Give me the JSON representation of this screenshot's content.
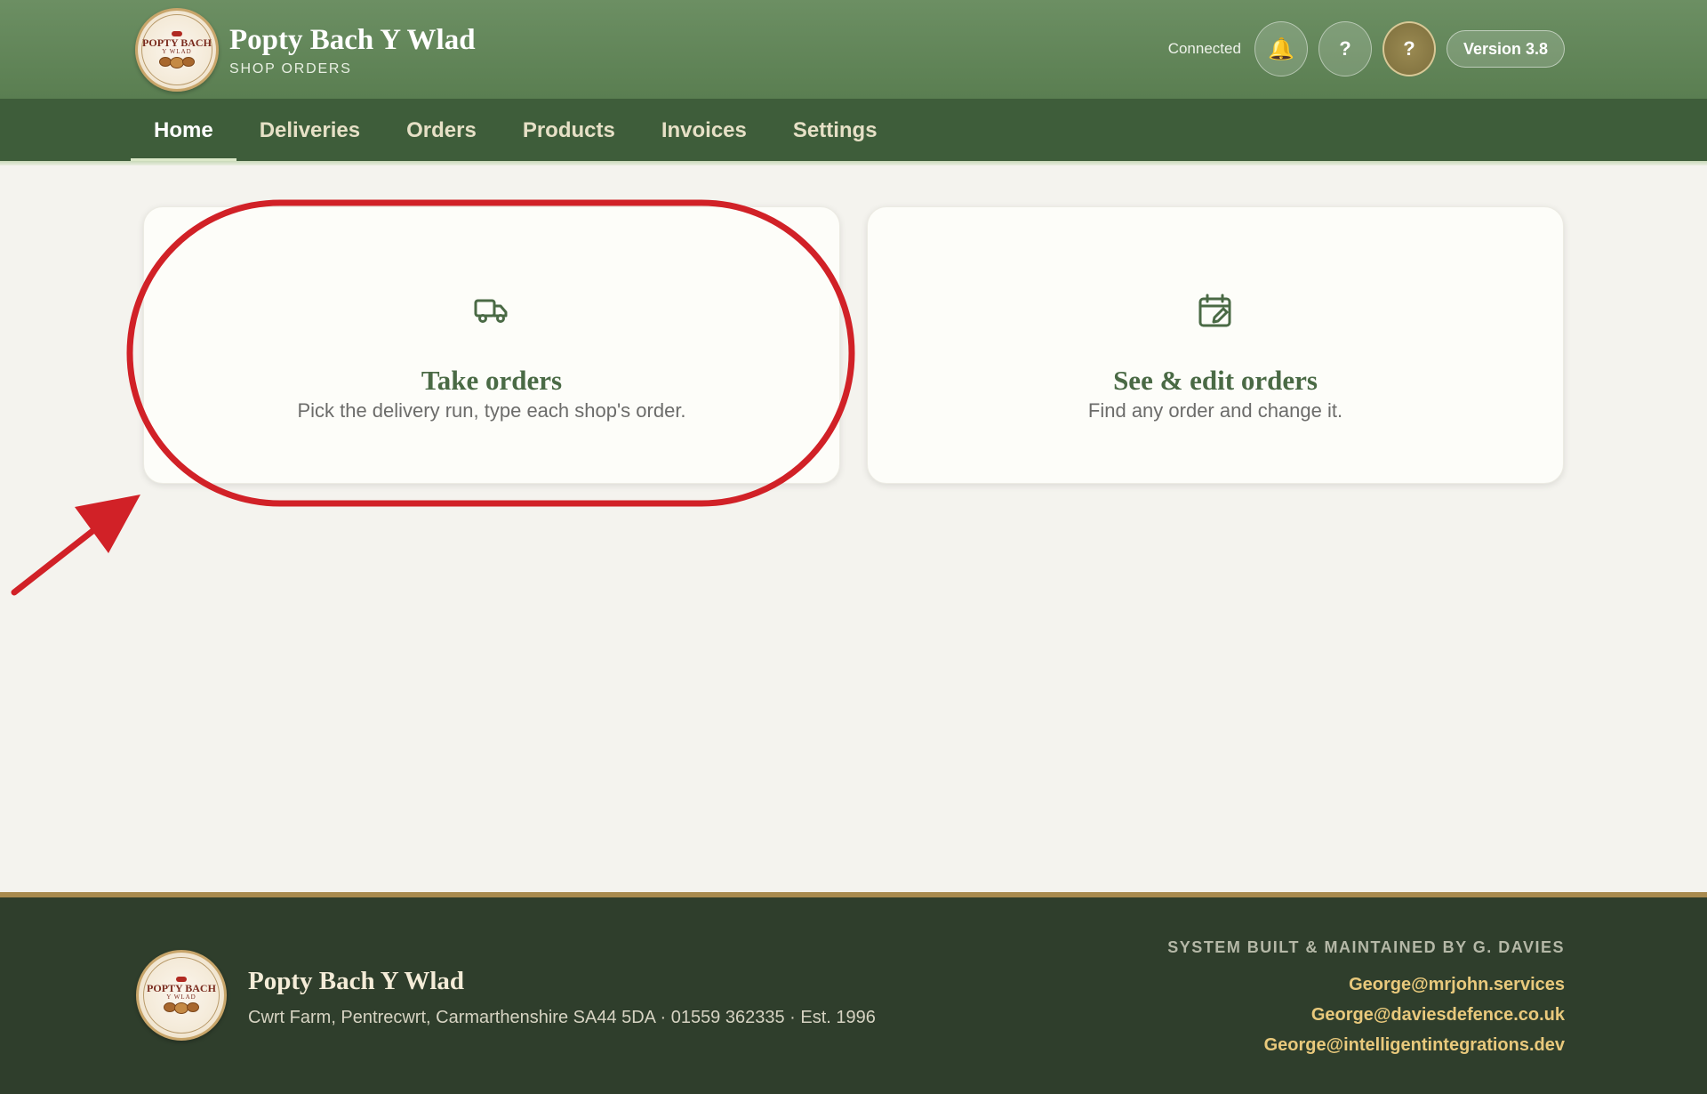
{
  "header": {
    "logo_text": "POPTY BACH",
    "logo_sub": "Y WLAD",
    "title": "Popty Bach Y Wlad",
    "subtitle": "SHOP ORDERS",
    "status": "Connected",
    "bell_icon": "🔔",
    "help_label": "?",
    "profile_label": "?",
    "version": "Version 3.8"
  },
  "nav": {
    "items": [
      "Home",
      "Deliveries",
      "Orders",
      "Products",
      "Invoices",
      "Settings"
    ],
    "active": "Home"
  },
  "cards": [
    {
      "icon": "truck-icon",
      "title": "Take orders",
      "desc": "Pick the delivery run, type each shop's order."
    },
    {
      "icon": "calendar-edit-icon",
      "title": "See & edit orders",
      "desc": "Find any order and change it."
    }
  ],
  "annotation": {
    "color": "#d12127"
  },
  "footer": {
    "title": "Popty Bach Y Wlad",
    "address": "Cwrt Farm, Pentrecwrt, Carmarthenshire SA44 5DA · 01559 362335 · Est. 1996",
    "credit": "SYSTEM BUILT & MAINTAINED BY G. DAVIES",
    "emails": [
      "George@mrjohn.services",
      "George@daviesdefence.co.uk",
      "George@intelligentintegrations.dev"
    ]
  },
  "colors": {
    "header": "#62875a",
    "nav": "#3e5d3a",
    "card_title": "#4a6a45",
    "footer": "#2f3e2c",
    "footer_email": "#e9c97c"
  }
}
